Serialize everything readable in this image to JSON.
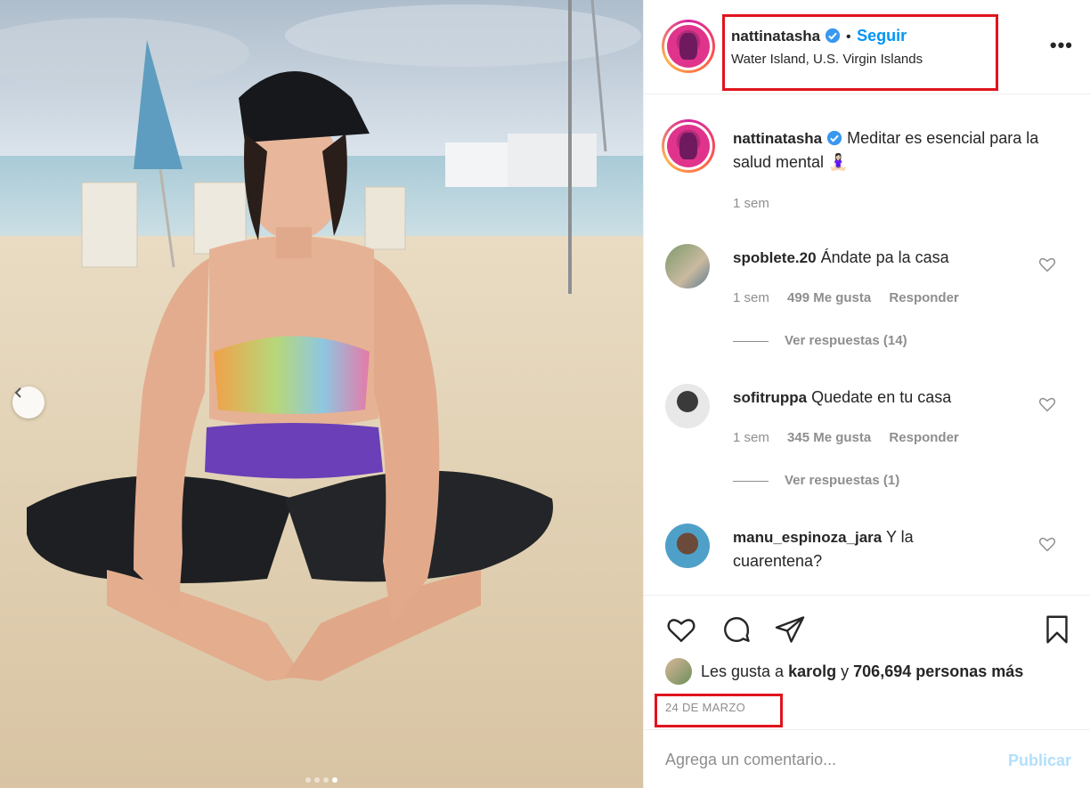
{
  "post": {
    "author": "nattinatasha",
    "follow_label": "Seguir",
    "separator": "•",
    "location": "Water Island, U.S. Virgin Islands",
    "more_label": "•••",
    "caption_text": "Meditar es esencial para la salud mental 🧘🏻‍♀️",
    "caption_time": "1 sem",
    "likes_prefix": "Les gusta a",
    "likes_user": "karolg",
    "likes_conj": "y",
    "likes_count": "706,694 personas más",
    "date": "24 DE MARZO",
    "comment_placeholder": "Agrega un comentario...",
    "publish_label": "Publicar"
  },
  "comments": [
    {
      "user": "spoblete.20",
      "text": "Ándate pa la casa",
      "time": "1 sem",
      "likes": "499 Me gusta",
      "reply": "Responder",
      "view_replies": "Ver respuestas (14)"
    },
    {
      "user": "sofitruppa",
      "text": "Quedate en tu casa",
      "time": "1 sem",
      "likes": "345 Me gusta",
      "reply": "Responder",
      "view_replies": "Ver respuestas (1)"
    },
    {
      "user": "manu_espinoza_jara",
      "text": "Y la cuarentena?"
    }
  ],
  "colors": {
    "verified": "#3897f0",
    "link": "#0095f6",
    "highlight": "#e0141e",
    "muted": "#8e8e8e"
  },
  "icons": [
    "verified-icon",
    "more-options-icon",
    "heart-icon",
    "comment-icon",
    "share-icon",
    "bookmark-icon",
    "carousel-prev-icon"
  ],
  "carousel": {
    "total_dots": 4,
    "active_dot": 4
  }
}
